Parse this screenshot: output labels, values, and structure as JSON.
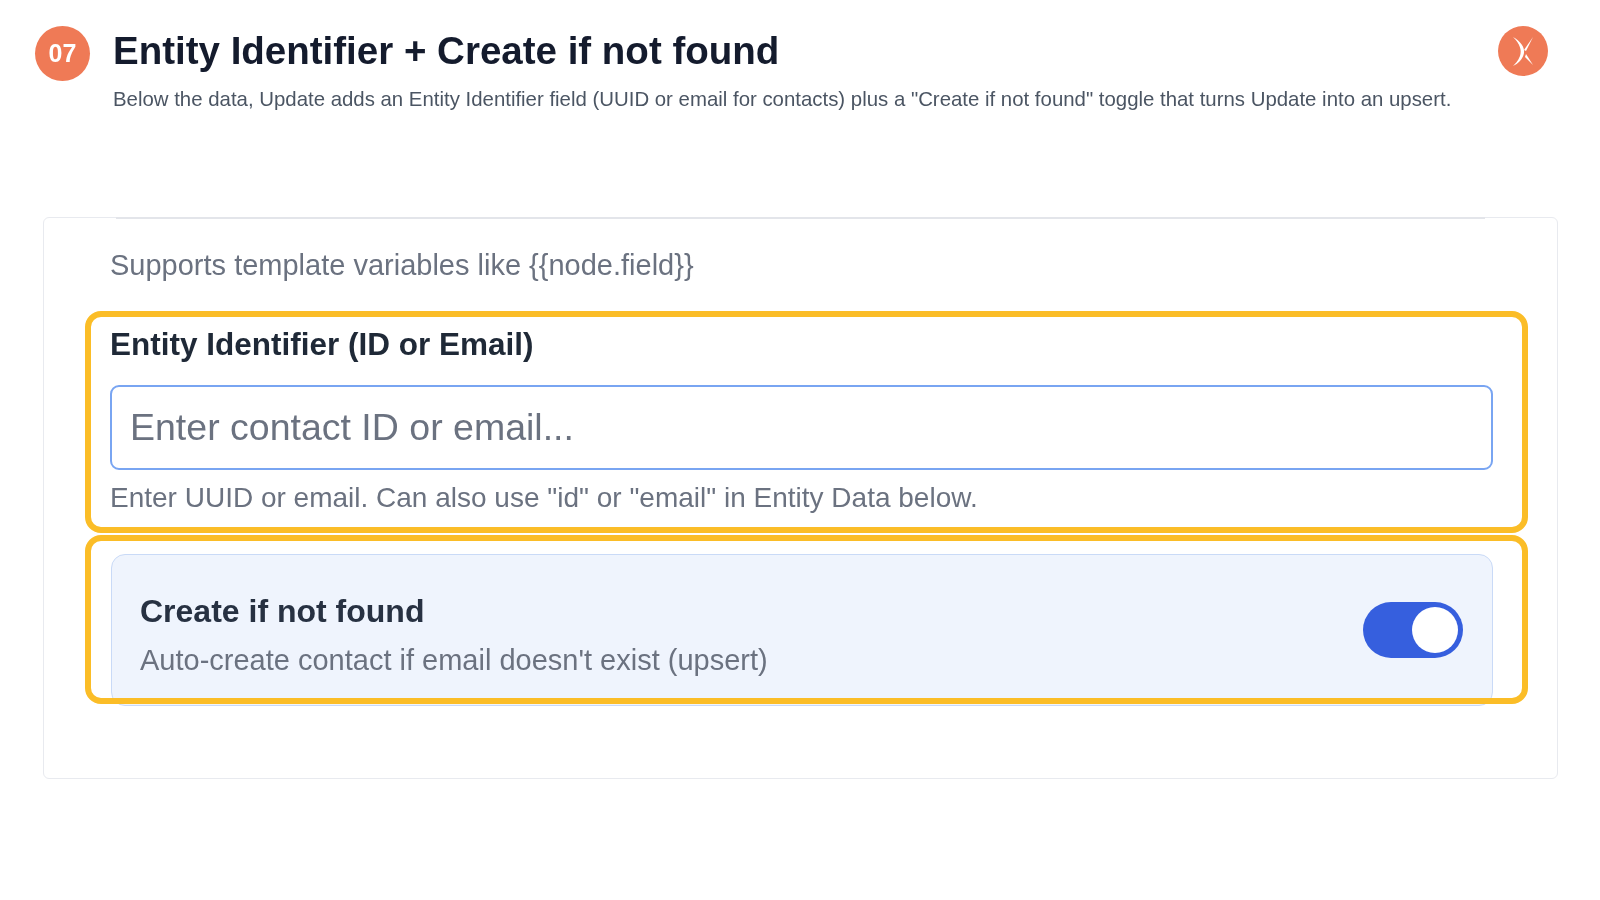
{
  "header": {
    "step": "07",
    "title": "Entity Identifier + Create if not found",
    "subtitle": "Below the data, Update adds an Entity Identifier field (UUID or email for contacts) plus a \"Create if not found\" toggle that turns Update into an upsert."
  },
  "card": {
    "hint": "Supports template variables like {{node.field}}"
  },
  "identifier_field": {
    "highlighted": true,
    "label": "Entity Identifier (ID or Email)",
    "placeholder": "Enter contact ID or email...",
    "help": "Enter UUID or email. Can also use \"id\" or \"email\" in Entity Data below."
  },
  "create_toggle": {
    "highlighted": true,
    "label": "Create if not found",
    "description": "Auto-create contact if email doesn't exist (upsert)",
    "on": true
  }
}
